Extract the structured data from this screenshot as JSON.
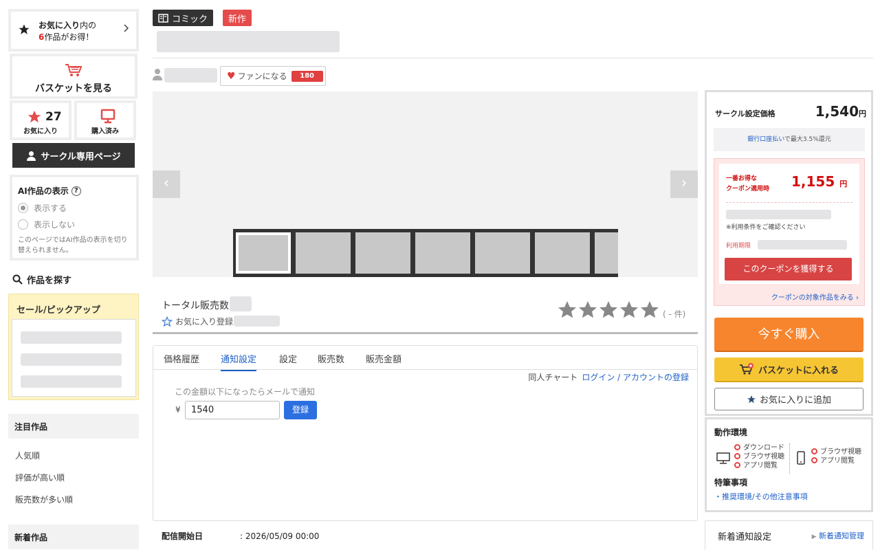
{
  "sidebar": {
    "fav_promo": {
      "line1_bold": "お気に入り",
      "line1_rest": "内の",
      "line2_num": "6",
      "line2_rest": "作品がお得！"
    },
    "basket_label": "バスケットを見る",
    "fav_count": "27",
    "fav_label": "お気に入り",
    "bought_label": "購入済み",
    "circle_page": "サークル専用ページ",
    "ai": {
      "title": "AI作品の表示",
      "help": "?",
      "show": "表示する",
      "hide": "表示しない",
      "note": "このページではAI作品の表示を切り替えられません。",
      "selected": "表示する"
    },
    "search_works": "作品を探す",
    "sale_pickup": "セール/ピックアップ",
    "featured_title": "注目作品",
    "featured_links": [
      "人気順",
      "評価が高い順",
      "販売数が多い順"
    ],
    "new_title": "新着作品"
  },
  "header": {
    "tag_comic": "コミック",
    "tag_new": "新作",
    "fan_label": "ファンになる",
    "fan_count": "180"
  },
  "gallery": {
    "prev": "‹",
    "next": "›"
  },
  "sales": {
    "total_label": "トータル販売数",
    "fav_reg_label": "お気に入り登録",
    "rating_count": "( - 件)",
    "rating_stars": 0
  },
  "tabs": {
    "items": [
      "価格履歴",
      "通知設定",
      "設定",
      "販売数",
      "販売金額"
    ],
    "active": "通知設定",
    "chart_label": "同人チャート",
    "login_link": "ログイン / アカウントの登録",
    "notify_label": "この金額以下になったらメールで通知",
    "yen": "¥",
    "price_value": "1540",
    "register": "登録"
  },
  "info": {
    "release_key": "配信開始日",
    "release_val": ": 2026/05/09 00:00"
  },
  "buy": {
    "price_label": "サークル設定価格",
    "price": "1,540",
    "yen_unit": "円",
    "bank_link": "銀行口座払い",
    "bank_rest": "で最大3.5%還元",
    "coupon_best_1": "一番お得な",
    "coupon_best_2": "クーポン適用時",
    "coupon_price": "1,155",
    "coupon_conditions": "※利用条件をご確認ください",
    "coupon_expiry": "利用期限",
    "coupon_get": "このクーポンを獲得する",
    "coupon_target": "クーポンの対象作品をみる",
    "buy_now": "今すぐ購入",
    "add_basket": "バスケットに入れる",
    "add_fav": "お気に入りに追加"
  },
  "env": {
    "title": "動作環境",
    "pc_items": [
      "ダウンロード",
      "ブラウザ視聴",
      "アプリ閲覧"
    ],
    "sp_items": [
      "ブラウザ視聴",
      "アプリ閲覧"
    ],
    "notes_title": "特筆事項",
    "notes_link": "・推奨環境/その他注意事項"
  },
  "new_notify": {
    "label": "新着通知設定",
    "manage": "新着通知管理"
  },
  "colors": {
    "accent_red": "#e54b4b",
    "orange": "#f7852d",
    "yellow": "#f6c533",
    "link": "#1d5fc8"
  }
}
